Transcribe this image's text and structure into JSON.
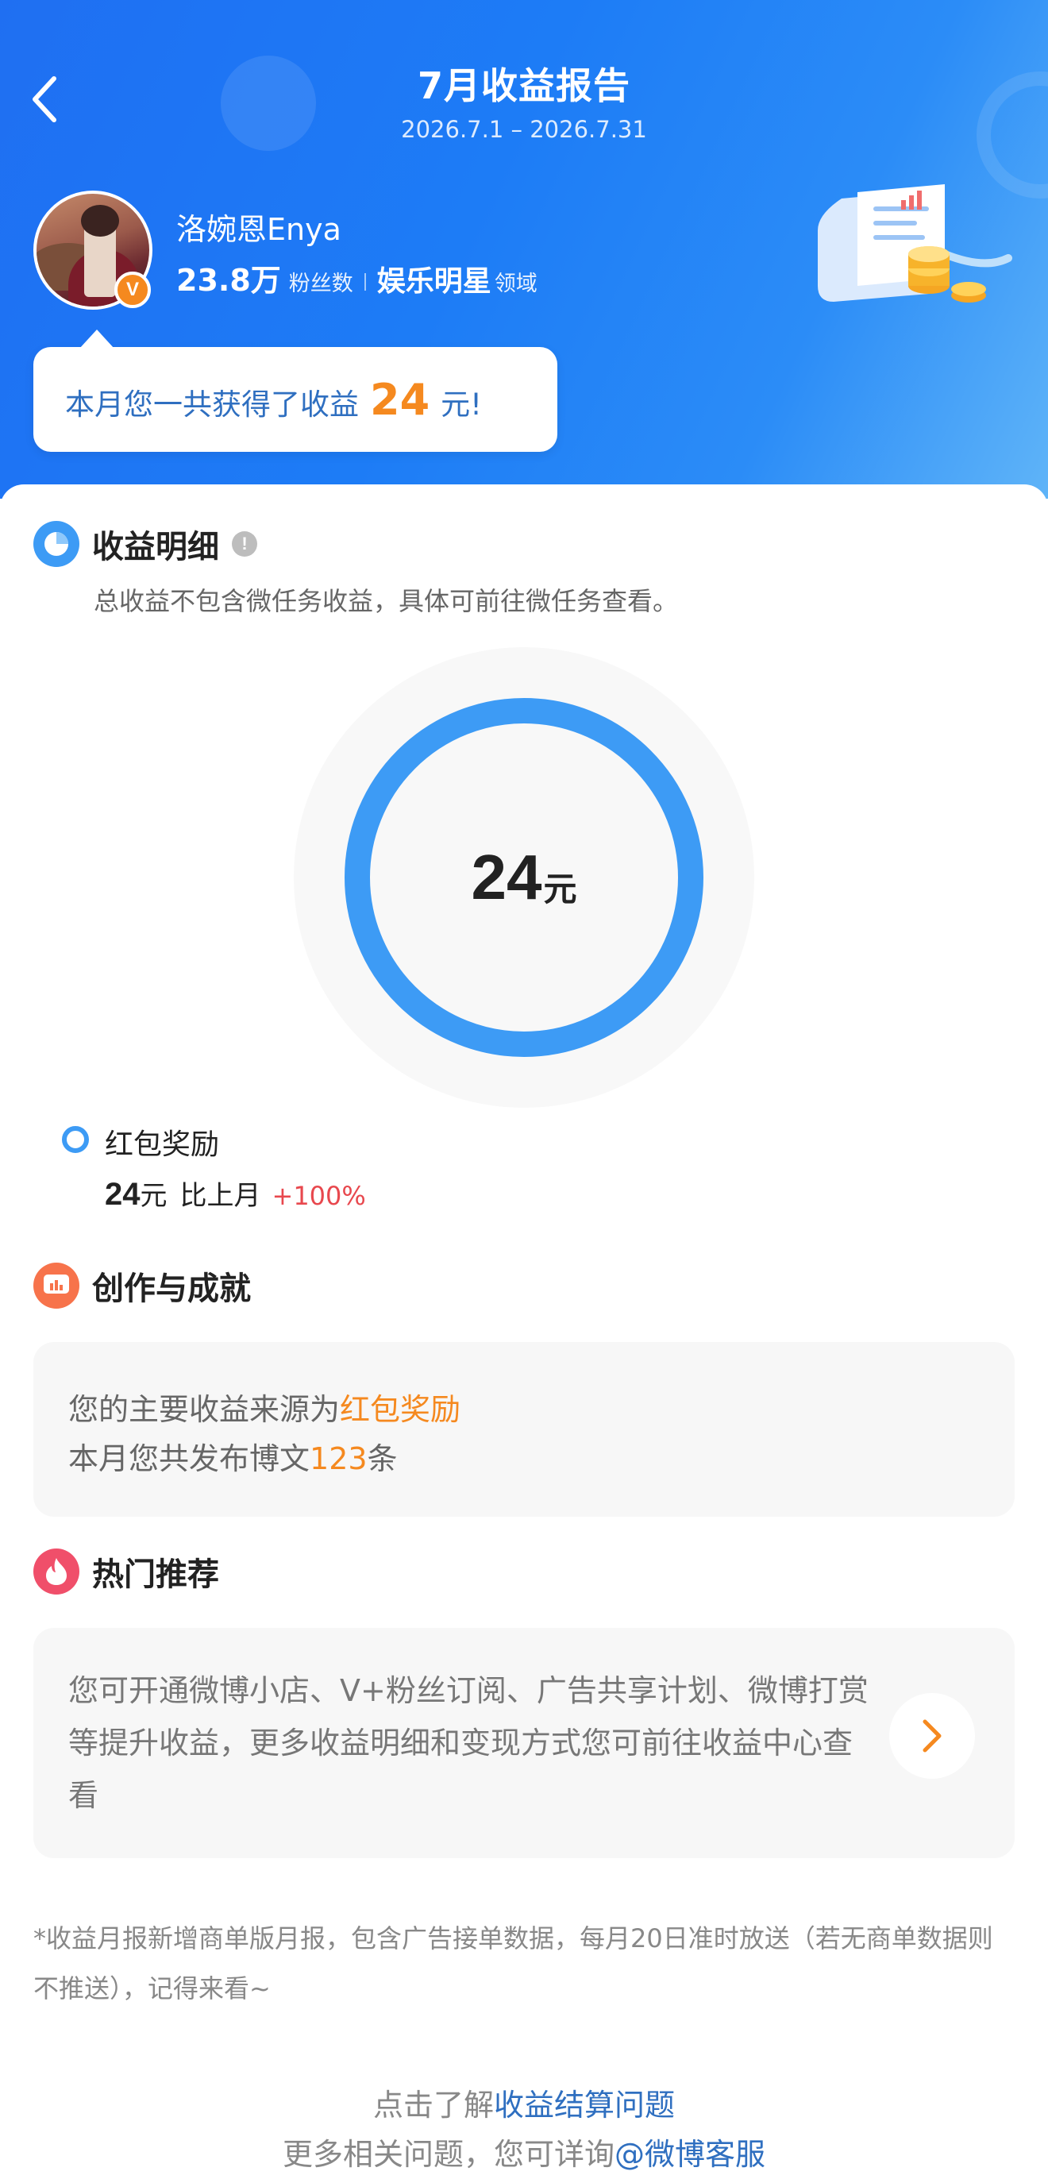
{
  "header": {
    "title": "7月收益报告",
    "date_range": "2026.7.1 – 2026.7.31"
  },
  "user": {
    "name": "洛婉恩Enya",
    "fans_count": "23.8万",
    "fans_label": "粉丝数",
    "domain": "娱乐明星",
    "domain_label": "领域",
    "verified_badge": "V"
  },
  "summary": {
    "prefix": "本月您一共获得了收益",
    "amount": "24",
    "suffix": "元!"
  },
  "income_detail": {
    "title": "收益明细",
    "description": "总收益不包含微任务收益，具体可前往微任务查看。",
    "total_value": "24",
    "total_unit": "元",
    "ring_fraction": 1.0,
    "legend": {
      "label": "红包奖励",
      "value": "24",
      "unit": "元",
      "compare_label": "比上月",
      "change": "+100%"
    }
  },
  "achievement": {
    "title": "创作与成就",
    "line1_prefix": "您的主要收益来源为",
    "line1_highlight": "红包奖励",
    "line2_prefix": "本月您共发布博文",
    "line2_highlight": "123",
    "line2_suffix": "条"
  },
  "hot": {
    "title": "热门推荐",
    "text": "您可开通微博小店、V+粉丝订阅、广告共享计划、微博打赏等提升收益，更多收益明细和变现方式您可前往收益中心查看"
  },
  "footnote": "*收益月报新增商单版月报，包含广告接单数据，每月20日准时放送（若无商单数据则不推送），记得来看~",
  "footer": {
    "line1_prefix": "点击了解",
    "line1_link": "收益结算问题",
    "line2_prefix": "更多相关问题，您可详询",
    "line2_link": "@微博客服"
  },
  "colors": {
    "header_blue": "#1f6ff2",
    "accent_orange": "#f5891f",
    "ring_blue": "#3d9bf5",
    "link_blue": "#2f6fc0",
    "increase_red": "#e8484e"
  },
  "icons": {
    "back": "back-chevron-icon",
    "income_detail": "pie-chart-icon",
    "achievement": "chart-board-icon",
    "hot": "flame-icon",
    "info": "info-icon",
    "arrow": "chevron-right-icon"
  }
}
